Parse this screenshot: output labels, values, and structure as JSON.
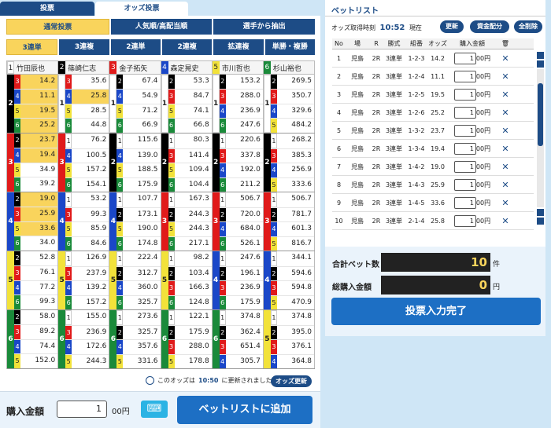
{
  "tabs": [
    "投票",
    "オッズ投票"
  ],
  "modes": [
    "通常投票",
    "人気順/高配当順",
    "選手から抽出"
  ],
  "bets": [
    "3連単",
    "3連複",
    "2連単",
    "2連複",
    "拡連複",
    "単勝・複勝"
  ],
  "racers": [
    {
      "num": "1",
      "name": "竹田辰也"
    },
    {
      "num": "2",
      "name": "篠崎仁志"
    },
    {
      "num": "3",
      "name": "金子拓矢"
    },
    {
      "num": "4",
      "name": "森定晃史"
    },
    {
      "num": "5",
      "name": "市川哲也"
    },
    {
      "num": "6",
      "name": "杉山裕也"
    }
  ],
  "blocks": [
    {
      "first": "1",
      "cols": [
        {
          "second": "2",
          "cells": [
            {
              "n": "3",
              "o": "14.2",
              "hl": true
            },
            {
              "n": "4",
              "o": "11.1",
              "hl": true
            },
            {
              "n": "5",
              "o": "19.5",
              "hl": true
            },
            {
              "n": "6",
              "o": "25.2",
              "hl": true
            }
          ]
        },
        {
          "second": "1",
          "cells": [
            {
              "n": "3",
              "o": "35.6"
            },
            {
              "n": "4",
              "o": "25.8",
              "hl": true
            },
            {
              "n": "5",
              "o": "28.5"
            },
            {
              "n": "6",
              "o": "44.8"
            }
          ]
        },
        {
          "second": "1",
          "cells": [
            {
              "n": "2",
              "o": "67.4"
            },
            {
              "n": "4",
              "o": "54.9"
            },
            {
              "n": "5",
              "o": "71.2"
            },
            {
              "n": "6",
              "o": "66.9"
            }
          ]
        },
        {
          "second": "1",
          "cells": [
            {
              "n": "2",
              "o": "53.3"
            },
            {
              "n": "3",
              "o": "84.7"
            },
            {
              "n": "5",
              "o": "74.1"
            },
            {
              "n": "6",
              "o": "66.8"
            }
          ]
        },
        {
          "second": "1",
          "cells": [
            {
              "n": "2",
              "o": "153.2"
            },
            {
              "n": "3",
              "o": "288.0"
            },
            {
              "n": "4",
              "o": "236.9"
            },
            {
              "n": "6",
              "o": "247.6"
            }
          ]
        },
        {
          "second": "1",
          "cells": [
            {
              "n": "2",
              "o": "269.5"
            },
            {
              "n": "3",
              "o": "350.7"
            },
            {
              "n": "4",
              "o": "329.6"
            },
            {
              "n": "5",
              "o": "484.2"
            }
          ]
        }
      ]
    },
    {
      "first": "3",
      "cols": [
        {
          "second": "3",
          "cells": [
            {
              "n": "2",
              "o": "23.7",
              "hl": true
            },
            {
              "n": "4",
              "o": "19.4",
              "hl": true
            },
            {
              "n": "5",
              "o": "34.9"
            },
            {
              "n": "6",
              "o": "39.2"
            }
          ]
        },
        {
          "second": "3",
          "cells": [
            {
              "n": "1",
              "o": "76.2"
            },
            {
              "n": "4",
              "o": "100.5"
            },
            {
              "n": "5",
              "o": "157.2"
            },
            {
              "n": "6",
              "o": "154.1"
            }
          ]
        },
        {
          "second": "2",
          "cells": [
            {
              "n": "1",
              "o": "115.6"
            },
            {
              "n": "4",
              "o": "139.0"
            },
            {
              "n": "5",
              "o": "188.5"
            },
            {
              "n": "6",
              "o": "175.9"
            }
          ]
        },
        {
          "second": "2",
          "cells": [
            {
              "n": "1",
              "o": "80.3"
            },
            {
              "n": "3",
              "o": "141.4"
            },
            {
              "n": "5",
              "o": "109.4"
            },
            {
              "n": "6",
              "o": "104.4"
            }
          ]
        },
        {
          "second": "2",
          "cells": [
            {
              "n": "1",
              "o": "220.6"
            },
            {
              "n": "3",
              "o": "337.8"
            },
            {
              "n": "4",
              "o": "192.0"
            },
            {
              "n": "6",
              "o": "211.2"
            }
          ]
        },
        {
          "second": "2",
          "cells": [
            {
              "n": "1",
              "o": "268.2"
            },
            {
              "n": "3",
              "o": "385.3"
            },
            {
              "n": "4",
              "o": "256.9"
            },
            {
              "n": "5",
              "o": "333.6"
            }
          ]
        }
      ]
    },
    {
      "first": "1",
      "cols": [
        {
          "second": "4",
          "cells": [
            {
              "n": "2",
              "o": "19.0",
              "hl": true
            },
            {
              "n": "3",
              "o": "25.9",
              "hl": true
            },
            {
              "n": "5",
              "o": "33.6",
              "hl": true
            },
            {
              "n": "6",
              "o": "34.0"
            }
          ]
        },
        {
          "second": "4",
          "cells": [
            {
              "n": "1",
              "o": "53.2"
            },
            {
              "n": "3",
              "o": "99.3"
            },
            {
              "n": "5",
              "o": "85.9"
            },
            {
              "n": "6",
              "o": "84.6"
            }
          ]
        },
        {
          "second": "4",
          "cells": [
            {
              "n": "1",
              "o": "107.7"
            },
            {
              "n": "2",
              "o": "173.1"
            },
            {
              "n": "5",
              "o": "190.0"
            },
            {
              "n": "6",
              "o": "174.8"
            }
          ]
        },
        {
          "second": "3",
          "cells": [
            {
              "n": "1",
              "o": "167.3"
            },
            {
              "n": "2",
              "o": "244.3"
            },
            {
              "n": "5",
              "o": "244.3"
            },
            {
              "n": "6",
              "o": "217.1"
            }
          ]
        },
        {
          "second": "3",
          "cells": [
            {
              "n": "1",
              "o": "506.7"
            },
            {
              "n": "2",
              "o": "720.0"
            },
            {
              "n": "4",
              "o": "684.0"
            },
            {
              "n": "6",
              "o": "526.1"
            }
          ]
        },
        {
          "second": "3",
          "cells": [
            {
              "n": "1",
              "o": "506.7"
            },
            {
              "n": "2",
              "o": "781.7"
            },
            {
              "n": "4",
              "o": "601.3"
            },
            {
              "n": "5",
              "o": "816.7"
            }
          ]
        }
      ]
    },
    {
      "first": "1",
      "cols": [
        {
          "second": "5",
          "cells": [
            {
              "n": "2",
              "o": "52.8"
            },
            {
              "n": "3",
              "o": "76.1"
            },
            {
              "n": "4",
              "o": "77.2"
            },
            {
              "n": "6",
              "o": "99.3"
            }
          ]
        },
        {
          "second": "5",
          "cells": [
            {
              "n": "1",
              "o": "126.9"
            },
            {
              "n": "3",
              "o": "237.9"
            },
            {
              "n": "4",
              "o": "139.2"
            },
            {
              "n": "6",
              "o": "157.2"
            }
          ]
        },
        {
          "second": "5",
          "cells": [
            {
              "n": "1",
              "o": "222.4"
            },
            {
              "n": "2",
              "o": "312.7"
            },
            {
              "n": "4",
              "o": "360.0"
            },
            {
              "n": "6",
              "o": "325.7"
            }
          ]
        },
        {
          "second": "5",
          "cells": [
            {
              "n": "1",
              "o": "98.2"
            },
            {
              "n": "2",
              "o": "103.4"
            },
            {
              "n": "3",
              "o": "166.3"
            },
            {
              "n": "6",
              "o": "124.8"
            }
          ]
        },
        {
          "second": "4",
          "cells": [
            {
              "n": "1",
              "o": "247.6"
            },
            {
              "n": "2",
              "o": "196.1"
            },
            {
              "n": "3",
              "o": "236.9"
            },
            {
              "n": "6",
              "o": "175.9"
            }
          ]
        },
        {
          "second": "4",
          "cells": [
            {
              "n": "1",
              "o": "344.1"
            },
            {
              "n": "2",
              "o": "594.6"
            },
            {
              "n": "3",
              "o": "594.8"
            },
            {
              "n": "5",
              "o": "470.9"
            }
          ]
        }
      ]
    },
    {
      "first": "1",
      "cols": [
        {
          "second": "6",
          "cells": [
            {
              "n": "2",
              "o": "58.0"
            },
            {
              "n": "3",
              "o": "89.2"
            },
            {
              "n": "4",
              "o": "74.4"
            },
            {
              "n": "5",
              "o": "152.0"
            }
          ]
        },
        {
          "second": "6",
          "cells": [
            {
              "n": "1",
              "o": "155.0"
            },
            {
              "n": "3",
              "o": "236.9"
            },
            {
              "n": "4",
              "o": "172.6"
            },
            {
              "n": "5",
              "o": "244.3"
            }
          ]
        },
        {
          "second": "6",
          "cells": [
            {
              "n": "1",
              "o": "273.6"
            },
            {
              "n": "2",
              "o": "325.7"
            },
            {
              "n": "4",
              "o": "357.6"
            },
            {
              "n": "5",
              "o": "331.6"
            }
          ]
        },
        {
          "second": "6",
          "cells": [
            {
              "n": "1",
              "o": "122.1"
            },
            {
              "n": "2",
              "o": "175.9"
            },
            {
              "n": "3",
              "o": "288.0"
            },
            {
              "n": "5",
              "o": "178.8"
            }
          ]
        },
        {
          "second": "6",
          "cells": [
            {
              "n": "1",
              "o": "374.8"
            },
            {
              "n": "2",
              "o": "362.4"
            },
            {
              "n": "3",
              "o": "651.4"
            },
            {
              "n": "4",
              "o": "305.7"
            }
          ]
        },
        {
          "second": "5",
          "cells": [
            {
              "n": "1",
              "o": "374.8"
            },
            {
              "n": "2",
              "o": "395.0"
            },
            {
              "n": "3",
              "o": "376.1"
            },
            {
              "n": "4",
              "o": "364.8"
            }
          ]
        }
      ]
    }
  ],
  "update": {
    "prefix": "このオッズは",
    "time": "10:50",
    "suffix": "に更新されました",
    "button": "オッズ更新"
  },
  "purchase": {
    "label": "購入金額",
    "value": "1",
    "unit": "00円",
    "add_button": "ベットリストに追加"
  },
  "betlist": {
    "title": "ベットリスト",
    "time_label": "オッズ取得時刻",
    "time": "10:52",
    "time_suffix": "現在",
    "buttons": [
      "更新",
      "資金配分",
      "全削除"
    ],
    "headers": [
      "No",
      "場",
      "R",
      "勝式",
      "組番",
      "オッズ",
      "購入金額"
    ],
    "rows": [
      {
        "no": "1",
        "place": "児島",
        "r": "2R",
        "type": "3連単",
        "combo": "1-2-3",
        "odds": "14.2",
        "amount": "1",
        "unit": "00円"
      },
      {
        "no": "2",
        "place": "児島",
        "r": "2R",
        "type": "3連単",
        "combo": "1-2-4",
        "odds": "11.1",
        "amount": "1",
        "unit": "00円"
      },
      {
        "no": "3",
        "place": "児島",
        "r": "2R",
        "type": "3連単",
        "combo": "1-2-5",
        "odds": "19.5",
        "amount": "1",
        "unit": "00円"
      },
      {
        "no": "4",
        "place": "児島",
        "r": "2R",
        "type": "3連単",
        "combo": "1-2-6",
        "odds": "25.2",
        "amount": "1",
        "unit": "00円"
      },
      {
        "no": "5",
        "place": "児島",
        "r": "2R",
        "type": "3連単",
        "combo": "1-3-2",
        "odds": "23.7",
        "amount": "1",
        "unit": "00円"
      },
      {
        "no": "6",
        "place": "児島",
        "r": "2R",
        "type": "3連単",
        "combo": "1-3-4",
        "odds": "19.4",
        "amount": "1",
        "unit": "00円"
      },
      {
        "no": "7",
        "place": "児島",
        "r": "2R",
        "type": "3連単",
        "combo": "1-4-2",
        "odds": "19.0",
        "amount": "1",
        "unit": "00円"
      },
      {
        "no": "8",
        "place": "児島",
        "r": "2R",
        "type": "3連単",
        "combo": "1-4-3",
        "odds": "25.9",
        "amount": "1",
        "unit": "00円"
      },
      {
        "no": "9",
        "place": "児島",
        "r": "2R",
        "type": "3連単",
        "combo": "1-4-5",
        "odds": "33.6",
        "amount": "1",
        "unit": "00円"
      },
      {
        "no": "10",
        "place": "児島",
        "r": "2R",
        "type": "3連単",
        "combo": "2-1-4",
        "odds": "25.8",
        "amount": "1",
        "unit": "00円"
      }
    ]
  },
  "summary": {
    "count_label": "合計ベット数",
    "count": "10",
    "count_unit": "件",
    "total_label": "総購入金額",
    "total": "0",
    "total_unit": "円",
    "done_button": "投票入力完了"
  },
  "colors": {
    "1": "#ffffff",
    "2": "#000000",
    "3": "#e01a1a",
    "4": "#1a47c8",
    "5": "#f2e23a",
    "6": "#1a8a3a"
  }
}
